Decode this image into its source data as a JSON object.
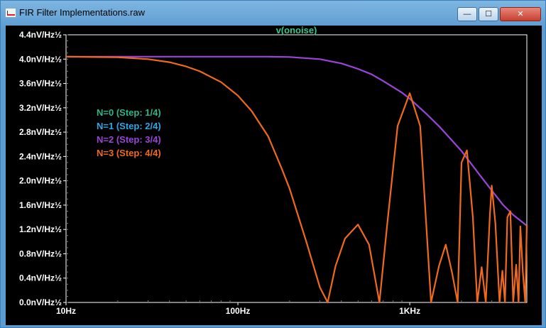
{
  "window": {
    "title": "FIR Filter Implementations.raw",
    "minimize_label": "—",
    "maximize_label": "☐",
    "close_label": "✕",
    "icon": "waveform-app-icon"
  },
  "colors": {
    "background": "#000000",
    "axis": "#ffffff",
    "grid": "#7a7a7a",
    "trace_title": "#39c98f"
  },
  "chart_data": {
    "type": "line",
    "title": "v(onoise)",
    "x_scale": "log",
    "xlim": [
      10,
      4800
    ],
    "ylim": [
      0.0,
      4.4
    ],
    "grid": "off",
    "legend_position": "left-center",
    "x_ticks": [
      {
        "value": 10,
        "label": "10Hz"
      },
      {
        "value": 100,
        "label": "100Hz"
      },
      {
        "value": 1000,
        "label": "1KHz"
      }
    ],
    "y_ticks": [
      {
        "value": 0.0,
        "label": "0.0nV/Hz½"
      },
      {
        "value": 0.4,
        "label": "0.4nV/Hz½"
      },
      {
        "value": 0.8,
        "label": "0.8nV/Hz½"
      },
      {
        "value": 1.2,
        "label": "1.2nV/Hz½"
      },
      {
        "value": 1.6,
        "label": "1.6nV/Hz½"
      },
      {
        "value": 2.0,
        "label": "2.0nV/Hz½"
      },
      {
        "value": 2.4,
        "label": "2.4nV/Hz½"
      },
      {
        "value": 2.8,
        "label": "2.8nV/Hz½"
      },
      {
        "value": 3.2,
        "label": "3.2nV/Hz½"
      },
      {
        "value": 3.6,
        "label": "3.6nV/Hz½"
      },
      {
        "value": 4.0,
        "label": "4.0nV/Hz½"
      },
      {
        "value": 4.4,
        "label": "4.4nV/Hz½"
      }
    ],
    "legend": [
      {
        "label": "N=0  (Step: 1/4)",
        "color": "#2fb58a"
      },
      {
        "label": "N=1  (Step: 2/4)",
        "color": "#2ea6e8"
      },
      {
        "label": "N=2  (Step: 3/4)",
        "color": "#9b45d8"
      },
      {
        "label": "N=3  (Step: 4/4)",
        "color": "#f06a1e"
      }
    ],
    "series": [
      {
        "name": "N=2",
        "color": "#9b45d8",
        "x": [
          10,
          20,
          50,
          100,
          150,
          200,
          300,
          400,
          500,
          600,
          700,
          800,
          900,
          1000,
          1250,
          1500,
          2000,
          2500,
          3000,
          3500,
          4000,
          4800
        ],
        "y": [
          4.04,
          4.04,
          4.04,
          4.04,
          4.04,
          4.035,
          4.0,
          3.93,
          3.84,
          3.75,
          3.64,
          3.54,
          3.45,
          3.35,
          3.1,
          2.88,
          2.49,
          2.13,
          1.84,
          1.6,
          1.44,
          1.26
        ]
      },
      {
        "name": "N=3",
        "color": "#f06a1e",
        "x": [
          10,
          20,
          30,
          40,
          50,
          60,
          80,
          100,
          120,
          150,
          180,
          200,
          250,
          300,
          333,
          370,
          420,
          500,
          580,
          666,
          740,
          850,
          1000,
          1150,
          1330,
          1480,
          1620,
          1760,
          1900,
          2000,
          2150,
          2330,
          2470,
          2620,
          2770,
          2920,
          3000,
          3150,
          3330,
          3460,
          3580,
          3700,
          3850,
          4000,
          4160,
          4300,
          4400,
          4550,
          4700,
          4800
        ],
        "y": [
          4.04,
          4.03,
          4.0,
          3.95,
          3.88,
          3.8,
          3.62,
          3.4,
          3.15,
          2.73,
          2.2,
          1.87,
          1.0,
          0.25,
          0.0,
          0.6,
          1.05,
          1.28,
          0.95,
          0.0,
          1.3,
          2.9,
          3.44,
          2.9,
          0.0,
          0.6,
          0.95,
          0.5,
          0.0,
          2.3,
          2.5,
          1.4,
          0.0,
          0.58,
          0.0,
          1.4,
          1.92,
          1.3,
          0.0,
          0.52,
          0.0,
          1.4,
          1.5,
          0.0,
          0.62,
          0.0,
          1.25,
          0.5,
          0.0,
          1.28
        ]
      }
    ]
  }
}
